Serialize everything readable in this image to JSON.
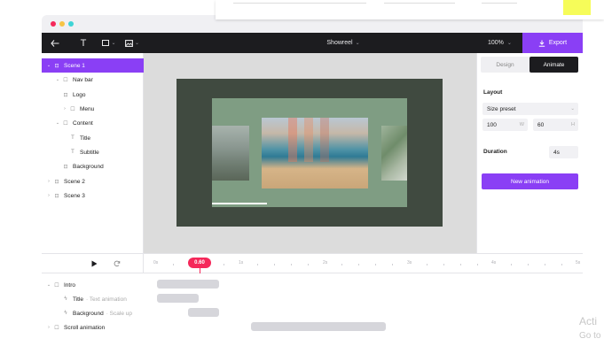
{
  "topbar": {
    "traffic_lights": [
      "#f5285a",
      "#f6c445",
      "#3ed4d6"
    ]
  },
  "toolbar": {
    "back_icon": "arrow-left-icon",
    "text_tool": "T",
    "shape_tool": "square-icon",
    "media_tool": "image-icon",
    "project_title": "Showreel",
    "zoom": "100%",
    "export_label": "Export"
  },
  "layers": {
    "items": [
      {
        "label": "Scene 1",
        "icon": "scene-icon",
        "selected": true
      },
      {
        "label": "Nav bar",
        "icon": "frame-icon"
      },
      {
        "label": "Logo",
        "icon": "image-icon"
      },
      {
        "label": "Menu",
        "icon": "frame-icon"
      },
      {
        "label": "Content",
        "icon": "frame-icon"
      },
      {
        "label": "Title",
        "icon": "text-icon"
      },
      {
        "label": "Subtitle",
        "icon": "text-icon"
      },
      {
        "label": "Background",
        "icon": "image-icon"
      },
      {
        "label": "Scene 2",
        "icon": "scene-icon"
      },
      {
        "label": "Scene 3",
        "icon": "scene-icon"
      }
    ]
  },
  "panel": {
    "tabs": [
      "Design",
      "Animate"
    ],
    "active_tab": "Animate",
    "layout_label": "Layout",
    "size_preset_label": "Size preset",
    "width_value": "100",
    "width_unit": "W",
    "height_value": "60",
    "height_unit": "H",
    "duration_label": "Duration",
    "duration_value": "4s",
    "new_animation_label": "New animation"
  },
  "timeline": {
    "playhead_time": "0.60",
    "ruler_labels": [
      "0s",
      "1s",
      "2s",
      "3s",
      "4s",
      "5s"
    ],
    "tracks": [
      {
        "label": "Intro",
        "sub": "",
        "icon": "frame-icon"
      },
      {
        "label": "Title",
        "sub": "· Text animation",
        "icon": "bolt-icon"
      },
      {
        "label": "Background",
        "sub": "· Scale up",
        "icon": "bolt-icon"
      },
      {
        "label": "Scroll animation",
        "sub": "",
        "icon": "frame-icon"
      }
    ]
  },
  "watermark": {
    "line1": "Acti",
    "line2": "Go to"
  }
}
